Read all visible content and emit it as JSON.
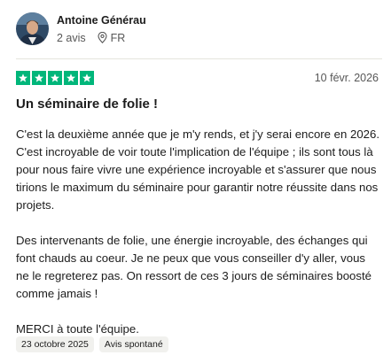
{
  "reviewer": {
    "name": "Antoine Générau",
    "review_count": "2 avis",
    "country": "FR",
    "avatar_icon": "avatar-photo",
    "location_icon": "location-pin-icon"
  },
  "review": {
    "rating": 5,
    "max_rating": 5,
    "star_color": "#00b67a",
    "date": "10 févr. 2026",
    "title": "Un séminaire de folie !",
    "paragraphs": [
      "C'est la deuxième année que je m'y rends, et j'y serai encore en 2026. C'est incroyable de voir toute l'implication de l'équipe ; ils sont tous là pour nous faire vivre une expérience incroyable et s'assurer que nous tirions le maximum du séminaire pour garantir notre réussite dans nos projets.",
      "Des intervenants de folie, une énergie incroyable, des échanges qui font chauds au coeur. Je ne peux que vous conseiller d'y aller, vous ne le regreterez pas. On ressort de ces 3 jours de séminaires boosté comme jamais !",
      "MERCI à toute l'équipe."
    ],
    "tags": [
      "23 octobre 2025",
      "Avis spontané"
    ]
  }
}
